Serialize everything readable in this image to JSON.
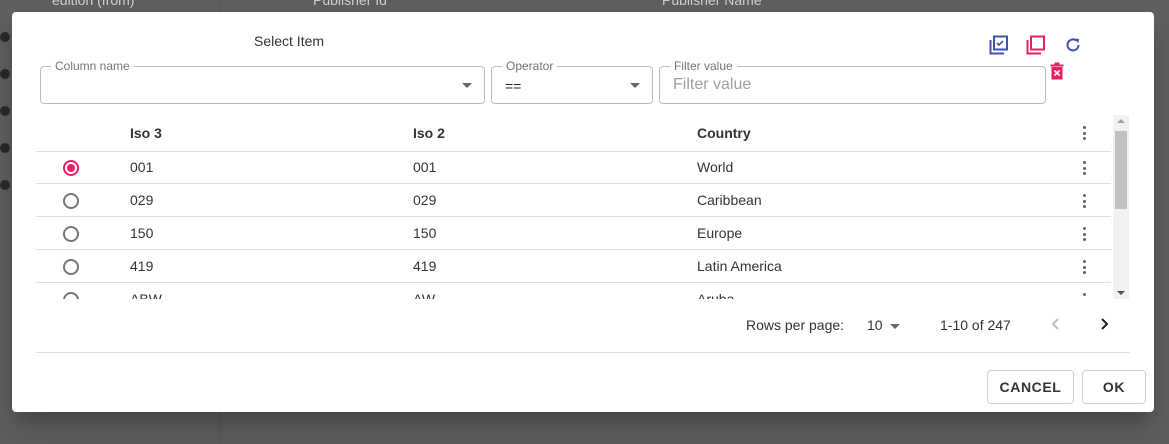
{
  "background": {
    "header_cells": [
      "edition (from)",
      "Publisher Id",
      "Publisher Name"
    ]
  },
  "dialog": {
    "title": "Select Item",
    "toolbar_icons": [
      "select-all-icon",
      "deselect-icon",
      "refresh-icon",
      "delete-filter-icon"
    ],
    "colors": {
      "accent": "#e91e63",
      "primary": "#3f51b5"
    }
  },
  "filters": {
    "column_name": {
      "label": "Column name",
      "value": ""
    },
    "operator": {
      "label": "Operator",
      "value": "=="
    },
    "filter_value": {
      "label": "Filter value",
      "placeholder": "Filter value",
      "value": ""
    }
  },
  "table": {
    "columns": [
      "Iso 3",
      "Iso 2",
      "Country"
    ],
    "selected_index": 0,
    "rows": [
      {
        "iso3": "001",
        "iso2": "001",
        "country": "World"
      },
      {
        "iso3": "029",
        "iso2": "029",
        "country": "Caribbean"
      },
      {
        "iso3": "150",
        "iso2": "150",
        "country": "Europe"
      },
      {
        "iso3": "419",
        "iso2": "419",
        "country": "Latin America"
      },
      {
        "iso3": "ABW",
        "iso2": "AW",
        "country": "Aruba"
      }
    ]
  },
  "pagination": {
    "rows_per_page_label": "Rows per page:",
    "rows_per_page": "10",
    "range": "1-10 of 247"
  },
  "actions": {
    "cancel": "CANCEL",
    "ok": "OK"
  }
}
